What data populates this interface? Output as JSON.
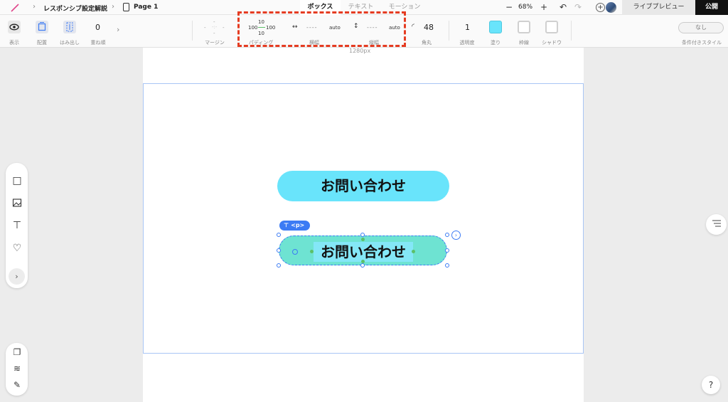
{
  "header": {
    "breadcrumb": [
      "レスポンシブ設定解説",
      "Page 1"
    ],
    "tabs": [
      "ボックス",
      "テキスト",
      "モーション"
    ],
    "active_tab": "ボックス",
    "zoom": "68%",
    "live_preview": "ライブプレビュー",
    "publish": "公開"
  },
  "toolbar": {
    "display": "表示",
    "layout": "配置",
    "overflow": "はみ出し",
    "z_index": "重ね順",
    "z_index_value": "0",
    "margin_label": "マージン",
    "padding_label": "パディング",
    "padding": {
      "top": "10",
      "left": "100",
      "right": "100",
      "bottom": "10"
    },
    "width_label": "横幅",
    "width_value": "auto",
    "width_placeholder": "----",
    "height_label": "縦幅",
    "height_value": "auto",
    "height_placeholder": "----",
    "radius_label": "角丸",
    "radius_value": "48",
    "opacity_label": "透明度",
    "opacity_value": "1",
    "fill_label": "塗り",
    "fill_color": "#69e4fb",
    "border_label": "枠線",
    "shadow_label": "シャドウ",
    "conditional_label": "条件付きスタイル",
    "conditional_value": "なし"
  },
  "canvas": {
    "width_label": "1280px",
    "button_text": "お問い合わせ",
    "selected_tag": "<p>",
    "selected_button_text": "お問い合わせ"
  },
  "colors": {
    "accent": "#3c7bf4",
    "highlight": "#e53c22",
    "button": "#69e4fb"
  }
}
